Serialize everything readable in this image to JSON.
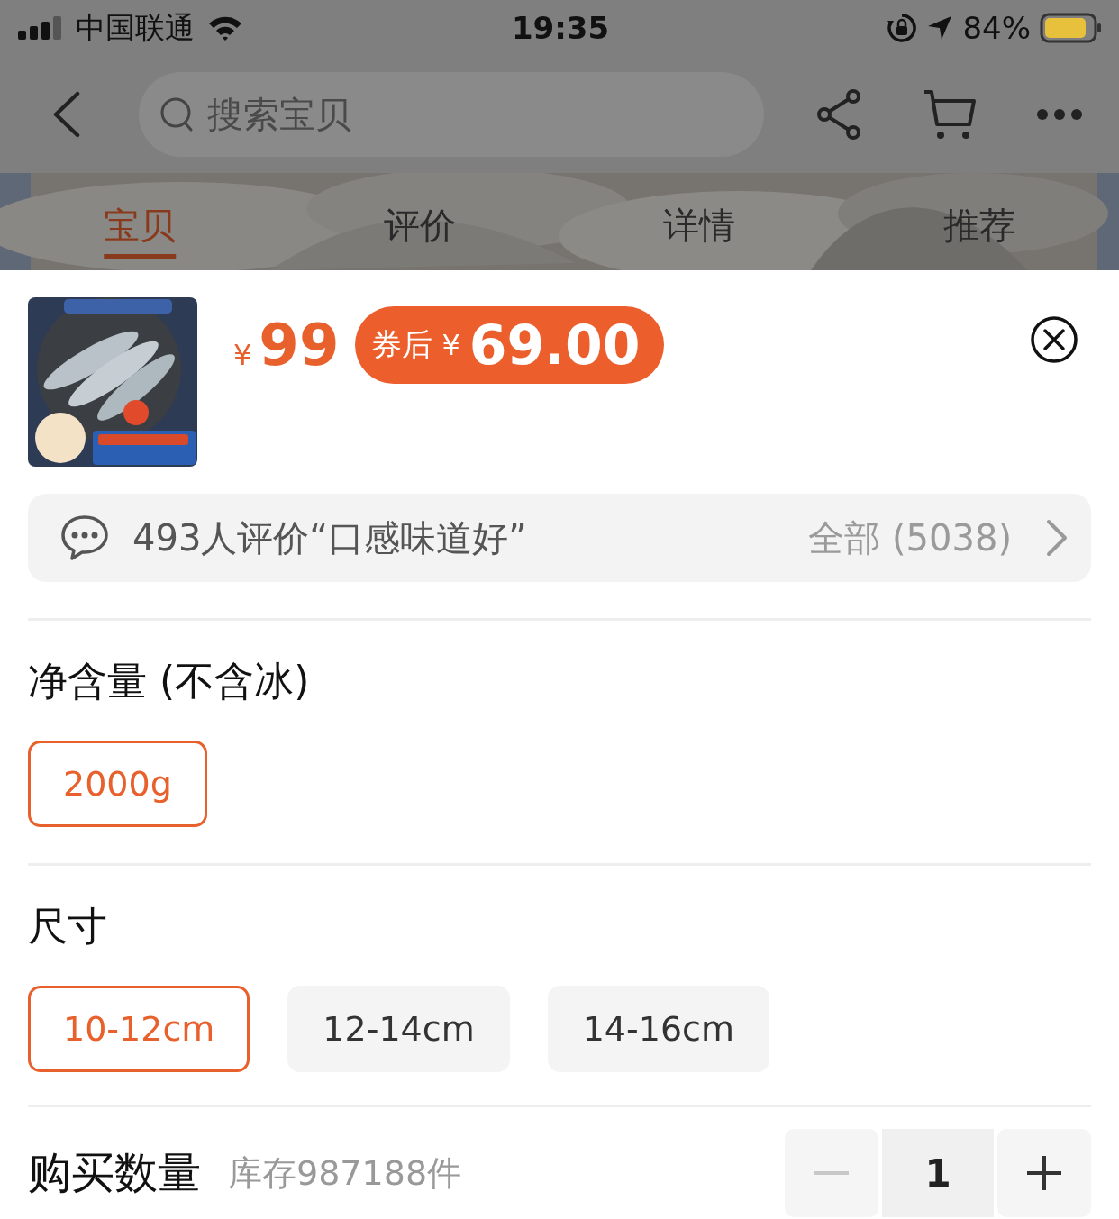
{
  "status_bar": {
    "carrier": "中国联通",
    "time": "19:35",
    "battery": "84%"
  },
  "nav": {
    "search": {
      "placeholder": "搜索宝贝"
    }
  },
  "tabs": [
    {
      "label": "宝贝",
      "selected": true
    },
    {
      "label": "评价",
      "selected": false
    },
    {
      "label": "详情",
      "selected": false
    },
    {
      "label": "推荐",
      "selected": false
    }
  ],
  "product": {
    "price": {
      "currency": "¥",
      "amount": "99"
    },
    "coupon": {
      "label": "券后",
      "currency": "¥",
      "amount": "69.00"
    }
  },
  "reviews": {
    "summary": "493人评价“口感味道好”",
    "all": "全部 (5038)"
  },
  "specs": [
    {
      "title": "净含量 (不含冰)",
      "options": [
        {
          "label": "2000g",
          "selected": true
        }
      ]
    },
    {
      "title": "尺寸",
      "options": [
        {
          "label": "10-12cm",
          "selected": true
        },
        {
          "label": "12-14cm",
          "selected": false
        },
        {
          "label": "14-16cm",
          "selected": false
        }
      ]
    }
  ],
  "quantity": {
    "label": "购买数量",
    "stock": "库存987188件",
    "value": "1",
    "decrease_disabled": true
  }
}
